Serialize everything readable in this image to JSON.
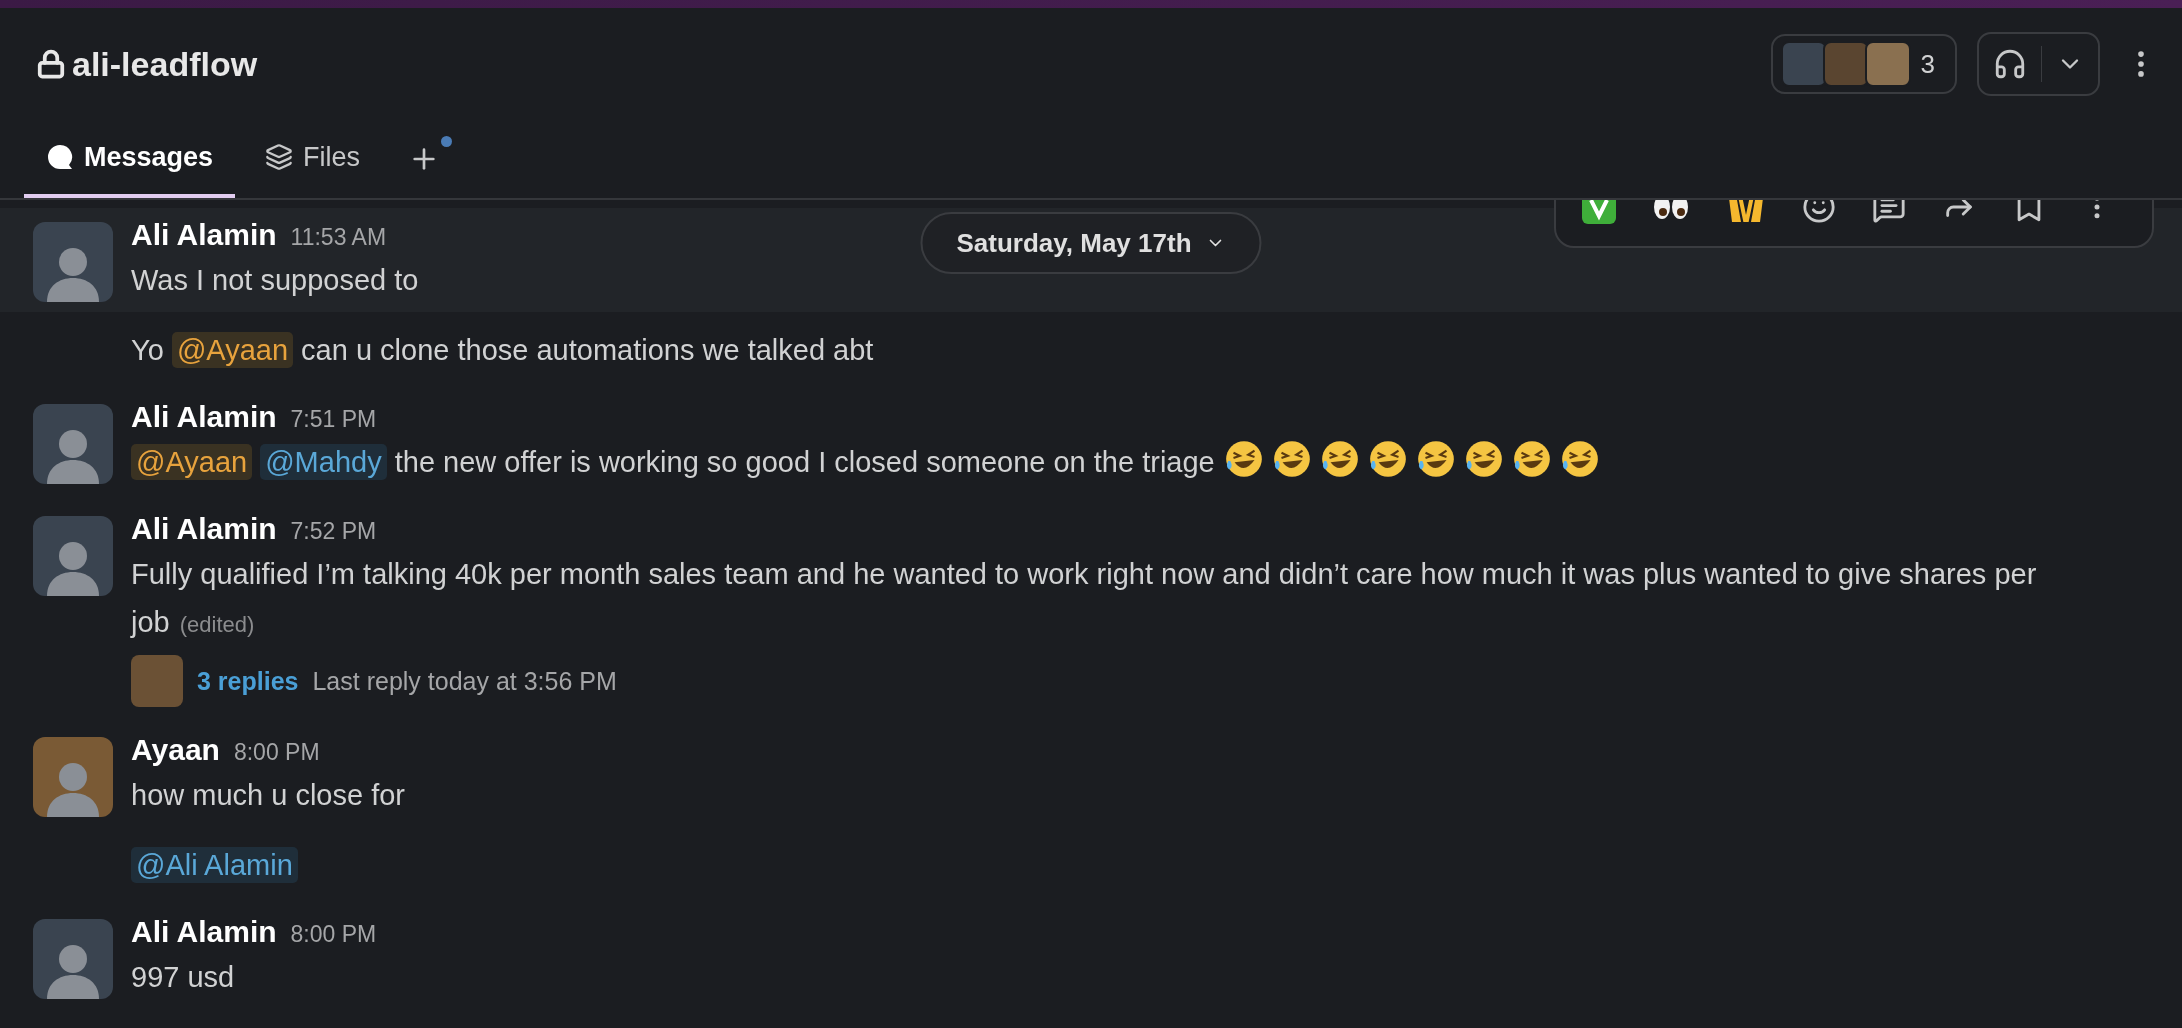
{
  "channel": {
    "title": "ali-leadflow",
    "private": true,
    "member_count": "3"
  },
  "tabs": [
    {
      "label": "Messages",
      "kind": "messages",
      "selected": true
    },
    {
      "label": "Files",
      "kind": "files",
      "selected": false
    }
  ],
  "add_tab": {
    "has_new": true
  },
  "date_divider": {
    "label": "Saturday, May 17th"
  },
  "hover_toolbar": [
    {
      "kind": "check"
    },
    {
      "kind": "eyes"
    },
    {
      "kind": "hands"
    },
    {
      "kind": "add-reaction"
    },
    {
      "kind": "reply"
    },
    {
      "kind": "forward"
    },
    {
      "kind": "bookmark"
    },
    {
      "kind": "more"
    }
  ],
  "messages": [
    {
      "kind": "message",
      "hovered": true,
      "author": "Ali Alamin",
      "time": "11:53 AM",
      "color": "#3a4450",
      "lines": [
        [
          {
            "kind": "text",
            "text": "Was I not supposed to"
          }
        ]
      ]
    },
    {
      "kind": "continuation",
      "hovered": false,
      "lines": [
        [
          {
            "kind": "text",
            "text": "Yo "
          },
          {
            "kind": "mention",
            "highlighted": true,
            "text": "@Ayaan"
          },
          {
            "kind": "text",
            "text": " can u clone those automations we talked abt"
          }
        ]
      ]
    },
    {
      "kind": "message",
      "hovered": false,
      "author": "Ali Alamin",
      "time": "7:51 PM",
      "color": "#3a4450",
      "lines": [
        [
          {
            "kind": "mention",
            "highlighted": true,
            "text": "@Ayaan"
          },
          {
            "kind": "mention",
            "highlighted": false,
            "text": "@Mahdy"
          },
          {
            "kind": "text",
            "text": " the new offer is working so good I closed someone on the triage "
          },
          {
            "kind": "emoji"
          },
          {
            "kind": "emoji"
          },
          {
            "kind": "emoji"
          },
          {
            "kind": "emoji"
          },
          {
            "kind": "emoji"
          },
          {
            "kind": "emoji"
          },
          {
            "kind": "emoji"
          },
          {
            "kind": "emoji"
          }
        ]
      ]
    },
    {
      "kind": "message",
      "hovered": false,
      "author": "Ali Alamin",
      "time": "7:52 PM",
      "color": "#3a4450",
      "lines": [
        [
          {
            "kind": "text",
            "text": "Fully qualified I’m talking 40k per month sales team and he wanted to work right now and didn’t care how much it was plus wanted to give shares per job"
          }
        ]
      ],
      "edited": "(edited)",
      "thread": {
        "replies": "3 replies",
        "last_reply": "Last reply today at 3:56 PM"
      }
    },
    {
      "kind": "message",
      "hovered": false,
      "author": "Ayaan",
      "time": "8:00 PM",
      "color": "#7a5a35",
      "lines": [
        [
          {
            "kind": "text",
            "text": "how much u close for"
          }
        ]
      ]
    },
    {
      "kind": "continuation",
      "hovered": false,
      "lines": [
        [
          {
            "kind": "mention",
            "highlighted": false,
            "text": "@Ali Alamin"
          }
        ]
      ]
    },
    {
      "kind": "message",
      "hovered": false,
      "author": "Ali Alamin",
      "time": "8:00 PM",
      "color": "#3a4450",
      "lines": [
        [
          {
            "kind": "text",
            "text": "997 usd"
          }
        ]
      ]
    }
  ]
}
